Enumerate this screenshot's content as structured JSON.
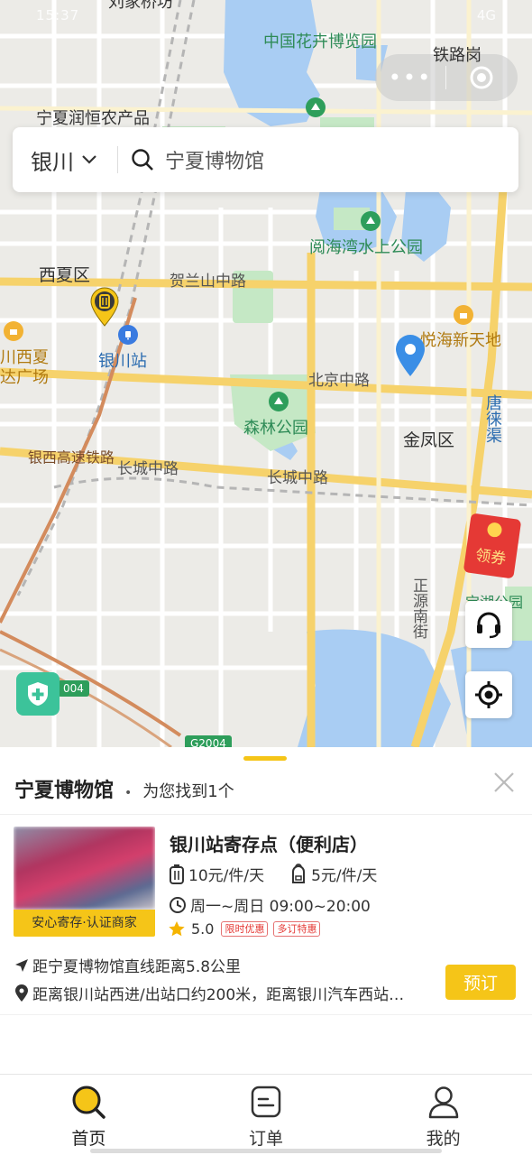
{
  "status_bar": {
    "time": "15:37",
    "right": "4G"
  },
  "capsule": {
    "menu_icon": "more-dots-icon",
    "close_icon": "target-circle-icon"
  },
  "search": {
    "city": "银川",
    "query": "宁夏博物馆"
  },
  "map": {
    "labels": {
      "liujia": "刘家桥坊",
      "flower_expo": "中国花卉博览园",
      "railway": "铁路岗",
      "runheng": "宁夏润恒农产品",
      "yuehai_park": "阅海湾水上公园",
      "xixia": "西夏区",
      "helanshan": "贺兰山中路",
      "yinchuan_station": "银川站",
      "left_plaza_1": "川西夏",
      "left_plaza_2": "达广场",
      "yuehai_new": "悦海新天地",
      "beijing_road": "北京中路",
      "forest_park": "森林公园",
      "jinfeng": "金凤区",
      "tanglai": "唐徕渠",
      "changcheng_1": "长城中路",
      "changcheng_2": "长城中路",
      "yinxi_rail": "银西高速铁路",
      "zhengyuan": "正源南街",
      "park_right": "宝湖公园",
      "badge_004": "004",
      "badge_g2004": "G2004"
    }
  },
  "sheet": {
    "title": "宁夏博物馆",
    "bullet": "•",
    "found": "为您找到1个",
    "store": {
      "image_tag": "安心寄存·认证商家",
      "name": "银川站寄存点（便利店）",
      "price_large": "10元/件/天",
      "price_small": "5元/件/天",
      "hours": "周一~周日 09:00~20:00",
      "rating": "5.0",
      "badge1": "限时优惠",
      "badge2": "多订特惠",
      "distance": "距宁夏博物馆直线距离5.8公里",
      "address": "距离银川站西进/出站口约200米，距离银川汽车西站…",
      "book": "预订"
    }
  },
  "coupon": {
    "label": "领券"
  },
  "tabs": [
    {
      "label": "首页",
      "icon": "search-icon"
    },
    {
      "label": "订单",
      "icon": "order-icon"
    },
    {
      "label": "我的",
      "icon": "user-icon"
    }
  ],
  "colors": {
    "accent": "#f5c518",
    "map_water": "#a9cdf3",
    "map_green": "#c5e8c5",
    "road_yellow": "#f6d26b",
    "badge_red": "#e53935"
  }
}
